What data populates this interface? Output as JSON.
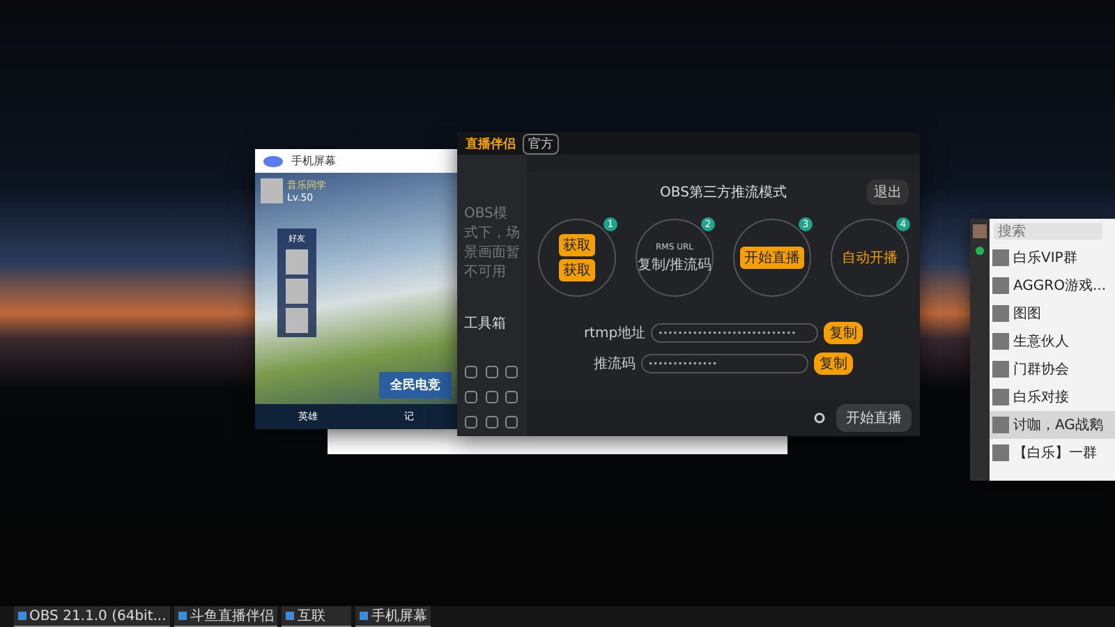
{
  "phone_window": {
    "title": "手机屏幕",
    "player": {
      "name": "音乐同学",
      "level": "Lv.50"
    },
    "friends_label": "好友",
    "banner": "全民电竞",
    "bottom_tabs": [
      "英雄",
      "记"
    ]
  },
  "main_window": {
    "logo": "直播伴侣",
    "badge": "官方",
    "sidebar_note": "OBS模式下，场景画面暂不可用",
    "toolbox": "工具箱",
    "mode_title": "OBS第三方推流模式",
    "exit_button": "退出",
    "steps": [
      {
        "number": "1",
        "kind": "pair",
        "items": [
          "获取",
          "获取"
        ]
      },
      {
        "number": "2",
        "kind": "text",
        "items": [
          "RMS URL",
          "复制/推流码"
        ]
      },
      {
        "number": "3",
        "kind": "button",
        "items": [
          "开始直播"
        ]
      },
      {
        "number": "4",
        "kind": "label",
        "items": [
          "自动开播"
        ]
      }
    ],
    "fields": [
      {
        "label": "rtmp地址",
        "value": "••••••••••••••••••••••••••••",
        "action": "复制"
      },
      {
        "label": "推流码",
        "value": "••••••••••••••",
        "action": "复制"
      }
    ],
    "start_button": "开始直播"
  },
  "chat_window": {
    "search": {
      "placeholder": "搜索"
    },
    "chats": [
      {
        "name": "白乐VIP群",
        "selected": false
      },
      {
        "name": "AGGRO游戏...",
        "selected": false
      },
      {
        "name": "图图",
        "selected": false
      },
      {
        "name": "生意伙人",
        "selected": false
      },
      {
        "name": "门群协会",
        "selected": false
      },
      {
        "name": "白乐对接",
        "selected": false
      },
      {
        "name": "讨咖，AG战鹅",
        "selected": true
      },
      {
        "name": "【白乐】一群",
        "selected": false
      }
    ]
  },
  "taskbar": [
    {
      "label": "OBS 21.1.0 (64bit..."
    },
    {
      "label": "斗鱼直播伴侣"
    },
    {
      "label": "互联"
    },
    {
      "label": "手机屏幕"
    }
  ]
}
